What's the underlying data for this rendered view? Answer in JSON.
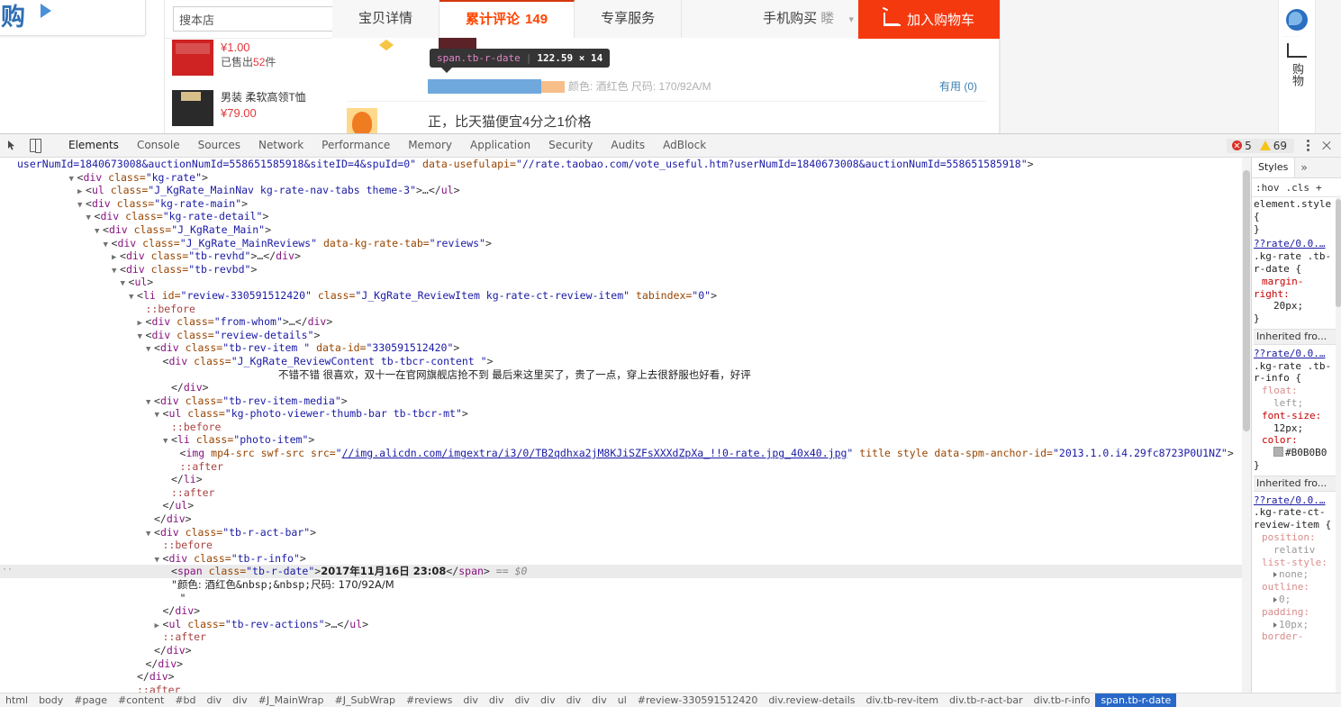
{
  "webpage": {
    "brand": {
      "logo_text": "购",
      "play_icon": "play-triangle-icon"
    },
    "search": {
      "value": "搜本店",
      "placeholder": "搜本店",
      "button_icon": "search-icon"
    },
    "products": [
      {
        "price": "¥1.00",
        "sold_prefix": "已售出",
        "sold_count": "52",
        "sold_suffix": "件",
        "title": ""
      },
      {
        "title": "男装 柔软高领T恤",
        "price": "¥79.00"
      }
    ],
    "tabs": [
      {
        "label": "宝贝详情",
        "active": false
      },
      {
        "label": "累计评论",
        "count": "149",
        "active": true
      },
      {
        "label": "专享服务",
        "active": false
      },
      {
        "label": "手机购买 ",
        "badge": "䁖",
        "caret": "chevron-down-icon",
        "active": false
      }
    ],
    "cart_button": {
      "label": "加入购物车",
      "icon": "cart-icon",
      "color": "#f5390f"
    },
    "review": {
      "date_highlight": "2017年11月16日 23:08",
      "attrs": "颜色: 酒红色  尺码: 170/92A/M",
      "useful": "有用 (0)",
      "second_review": "正，比天猫便宜4分之1价格"
    },
    "inspector_tooltip": {
      "selector": "span.tb-r-date",
      "dimensions": "122.59 × 14"
    },
    "rightrail": {
      "label": "购物"
    }
  },
  "devtools": {
    "toolbar": {
      "inspect_icon": "inspect-cursor-icon",
      "device_icon": "device-toolbar-icon",
      "tabs": [
        "Elements",
        "Console",
        "Sources",
        "Network",
        "Performance",
        "Memory",
        "Application",
        "Security",
        "Audits",
        "AdBlock"
      ],
      "active_tab": "Elements",
      "error_count": "5",
      "warning_count": "69",
      "menu_icon": "kebab-menu-icon",
      "close_icon": "close-icon"
    },
    "dom_lines": [
      {
        "indent": 0,
        "arrow": "none",
        "html": "<span class='tk-val'>userNumId=1840673008&amp;auctionNumId=558651585918&amp;siteID=4&amp;spuId=0\"</span> <span class='tk-attr'>data-usefulapi=</span><span class='tk-val'>\"//rate.taobao.com/vote_useful.htm?userNumId=1840673008&amp;auctionNumId=558651585918\"</span><span class='tk-punc'>&gt;</span>"
      },
      {
        "indent": 7,
        "arrow": "open",
        "html": "<span class='tk-punc'>&lt;</span><span class='tk-tag'>div</span> <span class='tk-attr'>class=</span><span class='tk-val'>\"kg-rate\"</span><span class='tk-punc'>&gt;</span>"
      },
      {
        "indent": 8,
        "arrow": "closed",
        "html": "<span class='tk-punc'>&lt;</span><span class='tk-tag'>ul</span> <span class='tk-attr'>class=</span><span class='tk-val'>\"J_KgRate_MainNav kg-rate-nav-tabs theme-3\"</span><span class='tk-punc'>&gt;…&lt;/</span><span class='tk-tag'>ul</span><span class='tk-punc'>&gt;</span>"
      },
      {
        "indent": 8,
        "arrow": "open",
        "html": "<span class='tk-punc'>&lt;</span><span class='tk-tag'>div</span> <span class='tk-attr'>class=</span><span class='tk-val'>\"kg-rate-main\"</span><span class='tk-punc'>&gt;</span>"
      },
      {
        "indent": 9,
        "arrow": "open",
        "html": "<span class='tk-punc'>&lt;</span><span class='tk-tag'>div</span> <span class='tk-attr'>class=</span><span class='tk-val'>\"kg-rate-detail\"</span><span class='tk-punc'>&gt;</span>"
      },
      {
        "indent": 10,
        "arrow": "open",
        "html": "<span class='tk-punc'>&lt;</span><span class='tk-tag'>div</span> <span class='tk-attr'>class=</span><span class='tk-val'>\"J_KgRate_Main\"</span><span class='tk-punc'>&gt;</span>"
      },
      {
        "indent": 11,
        "arrow": "open",
        "html": "<span class='tk-punc'>&lt;</span><span class='tk-tag'>div</span> <span class='tk-attr'>class=</span><span class='tk-val'>\"J_KgRate_MainReviews\"</span> <span class='tk-attr'>data-kg-rate-tab=</span><span class='tk-val'>\"reviews\"</span><span class='tk-punc'>&gt;</span>"
      },
      {
        "indent": 12,
        "arrow": "closed",
        "html": "<span class='tk-punc'>&lt;</span><span class='tk-tag'>div</span> <span class='tk-attr'>class=</span><span class='tk-val'>\"tb-revhd\"</span><span class='tk-punc'>&gt;…&lt;/</span><span class='tk-tag'>div</span><span class='tk-punc'>&gt;</span>"
      },
      {
        "indent": 12,
        "arrow": "open",
        "html": "<span class='tk-punc'>&lt;</span><span class='tk-tag'>div</span> <span class='tk-attr'>class=</span><span class='tk-val'>\"tb-revbd\"</span><span class='tk-punc'>&gt;</span>"
      },
      {
        "indent": 13,
        "arrow": "open",
        "html": "<span class='tk-punc'>&lt;</span><span class='tk-tag'>ul</span><span class='tk-punc'>&gt;</span>"
      },
      {
        "indent": 14,
        "arrow": "open",
        "html": "<span class='tk-punc'>&lt;</span><span class='tk-tag'>li</span> <span class='tk-attr'>id=</span><span class='tk-val'>\"review-330591512420\"</span> <span class='tk-attr'>class=</span><span class='tk-val'>\"J_KgRate_ReviewItem kg-rate-ct-review-item\"</span> <span class='tk-attr'>tabindex=</span><span class='tk-val'>\"0\"</span><span class='tk-punc'>&gt;</span>"
      },
      {
        "indent": 15,
        "arrow": "none",
        "html": "<span class='tk-pseudo'>::before</span>"
      },
      {
        "indent": 15,
        "arrow": "closed",
        "html": "<span class='tk-punc'>&lt;</span><span class='tk-tag'>div</span> <span class='tk-attr'>class=</span><span class='tk-val'>\"from-whom\"</span><span class='tk-punc'>&gt;…&lt;/</span><span class='tk-tag'>div</span><span class='tk-punc'>&gt;</span>"
      },
      {
        "indent": 15,
        "arrow": "open",
        "html": "<span class='tk-punc'>&lt;</span><span class='tk-tag'>div</span> <span class='tk-attr'>class=</span><span class='tk-val'>\"review-details\"</span><span class='tk-punc'>&gt;</span>"
      },
      {
        "indent": 16,
        "arrow": "open",
        "html": "<span class='tk-punc'>&lt;</span><span class='tk-tag'>div</span> <span class='tk-attr'>class=</span><span class='tk-val'>\"tb-rev-item \"</span> <span class='tk-attr'>data-id=</span><span class='tk-val'>\"330591512420\"</span><span class='tk-punc'>&gt;</span>"
      },
      {
        "indent": 17,
        "arrow": "none",
        "html": "<span class='tk-punc'>&lt;</span><span class='tk-tag'>div</span> <span class='tk-attr'>class=</span><span class='tk-val'>\"J_KgRate_ReviewContent tb-tbcr-content \"</span><span class='tk-punc'>&gt;</span>"
      },
      {
        "indent": 0,
        "arrow": "none",
        "center": true,
        "html": "<span class='tk-cjk'>不错不错 很喜欢，双十一在官网旗舰店抢不到 最后来这里买了，贵了一点，穿上去很舒服也好看，好评</span>"
      },
      {
        "indent": 18,
        "arrow": "none",
        "html": "<span class='tk-punc'>&lt;/</span><span class='tk-tag'>div</span><span class='tk-punc'>&gt;</span>"
      },
      {
        "indent": 16,
        "arrow": "open",
        "html": "<span class='tk-punc'>&lt;</span><span class='tk-tag'>div</span> <span class='tk-attr'>class=</span><span class='tk-val'>\"tb-rev-item-media\"</span><span class='tk-punc'>&gt;</span>"
      },
      {
        "indent": 17,
        "arrow": "open",
        "html": "<span class='tk-punc'>&lt;</span><span class='tk-tag'>ul</span> <span class='tk-attr'>class=</span><span class='tk-val'>\"kg-photo-viewer-thumb-bar tb-tbcr-mt\"</span><span class='tk-punc'>&gt;</span>"
      },
      {
        "indent": 18,
        "arrow": "none",
        "html": "<span class='tk-pseudo'>::before</span>"
      },
      {
        "indent": 18,
        "arrow": "open",
        "html": "<span class='tk-punc'>&lt;</span><span class='tk-tag'>li</span> <span class='tk-attr'>class=</span><span class='tk-val'>\"photo-item\"</span><span class='tk-punc'>&gt;</span>"
      },
      {
        "indent": 19,
        "arrow": "none",
        "html": "<span class='tk-punc'>&lt;</span><span class='tk-tag'>img</span> <span class='tk-attr'>mp4-src</span> <span class='tk-attr'>swf-src</span> <span class='tk-attr'>src=</span><span class='tk-val'>\"</span><span class='tk-link'>//img.alicdn.com/imgextra/i3/0/TB2qdhxa2jM8KJiSZFsXXXdZpXa_!!0-rate.jpg_40x40.jpg</span><span class='tk-val'>\"</span> <span class='tk-attr'>title</span> <span class='tk-attr'>style</span> <span class='tk-attr'>data-spm-anchor-id=</span><span class='tk-val'>\"2013.1.0.i4.29fc8723P0U1NZ\"</span><span class='tk-punc'>&gt;</span>"
      },
      {
        "indent": 19,
        "arrow": "none",
        "html": "<span class='tk-pseudo'>::after</span>"
      },
      {
        "indent": 18,
        "arrow": "none",
        "html": "<span class='tk-punc'>&lt;/</span><span class='tk-tag'>li</span><span class='tk-punc'>&gt;</span>"
      },
      {
        "indent": 18,
        "arrow": "none",
        "html": "<span class='tk-pseudo'>::after</span>"
      },
      {
        "indent": 17,
        "arrow": "none",
        "html": "<span class='tk-punc'>&lt;/</span><span class='tk-tag'>ul</span><span class='tk-punc'>&gt;</span>"
      },
      {
        "indent": 16,
        "arrow": "none",
        "html": "<span class='tk-punc'>&lt;/</span><span class='tk-tag'>div</span><span class='tk-punc'>&gt;</span>"
      },
      {
        "indent": 16,
        "arrow": "open",
        "html": "<span class='tk-punc'>&lt;</span><span class='tk-tag'>div</span> <span class='tk-attr'>class=</span><span class='tk-val'>\"tb-r-act-bar\"</span><span class='tk-punc'>&gt;</span>"
      },
      {
        "indent": 17,
        "arrow": "none",
        "html": "<span class='tk-pseudo'>::before</span>"
      },
      {
        "indent": 17,
        "arrow": "open",
        "html": "<span class='tk-punc'>&lt;</span><span class='tk-tag'>div</span> <span class='tk-attr'>class=</span><span class='tk-val'>\"tb-r-info\"</span><span class='tk-punc'>&gt;</span>"
      },
      {
        "indent": 18,
        "arrow": "none",
        "selected": true,
        "html": "<span class='tk-punc'>&lt;</span><span class='tk-tag'>span</span> <span class='tk-attr'>class=</span><span class='tk-val'>\"tb-r-date\"</span><span class='tk-punc'>&gt;</span><b class='tk-cjk'>2017年11月16日  23:08</b><span class='tk-punc'>&lt;/</span><span class='tk-tag'>span</span><span class='tk-punc'>&gt;</span> <span class='tk-eq'>== $0</span>"
      },
      {
        "indent": 18,
        "arrow": "none",
        "html": "<span class='tk-txt'>\"</span><span class='tk-cjk'>颜色: 酒红色</span><span class='tk-txt'>&amp;nbsp;&amp;nbsp;</span><span class='tk-cjk'>尺码: 170/92A/M</span>"
      },
      {
        "indent": 19,
        "arrow": "none",
        "html": "<span class='tk-txt'>\"</span>"
      },
      {
        "indent": 17,
        "arrow": "none",
        "html": "<span class='tk-punc'>&lt;/</span><span class='tk-tag'>div</span><span class='tk-punc'>&gt;</span>"
      },
      {
        "indent": 17,
        "arrow": "closed",
        "html": "<span class='tk-punc'>&lt;</span><span class='tk-tag'>ul</span> <span class='tk-attr'>class=</span><span class='tk-val'>\"tb-rev-actions\"</span><span class='tk-punc'>&gt;…&lt;/</span><span class='tk-tag'>ul</span><span class='tk-punc'>&gt;</span>"
      },
      {
        "indent": 17,
        "arrow": "none",
        "html": "<span class='tk-pseudo'>::after</span>"
      },
      {
        "indent": 16,
        "arrow": "none",
        "html": "<span class='tk-punc'>&lt;/</span><span class='tk-tag'>div</span><span class='tk-punc'>&gt;</span>"
      },
      {
        "indent": 15,
        "arrow": "none",
        "html": "<span class='tk-punc'>&lt;/</span><span class='tk-tag'>div</span><span class='tk-punc'>&gt;</span>"
      },
      {
        "indent": 14,
        "arrow": "none",
        "html": "<span class='tk-punc'>&lt;/</span><span class='tk-tag'>div</span><span class='tk-punc'>&gt;</span>"
      },
      {
        "indent": 14,
        "arrow": "none",
        "html": "<span class='tk-pseudo'>::after</span>"
      }
    ],
    "styles": {
      "tab_label": "Styles",
      "more_icon": "chevron-right-icon",
      "filters": [
        ":hov",
        ".cls",
        "+"
      ],
      "rules": [
        {
          "source": "",
          "selector": "element.style {",
          "declarations": [],
          "close": "}"
        },
        {
          "source": "??rate/0.0.…",
          "selector": ".kg-rate .tb-r-date {",
          "declarations": [
            {
              "prop": "margin-right:",
              "value": "20px;",
              "dim": false
            }
          ],
          "close": "}"
        },
        {
          "inherit_label": "Inherited fro...",
          "source": "??rate/0.0.…",
          "selector": ".kg-rate .tb-r-info {",
          "declarations": [
            {
              "prop": "float:",
              "value": "left;",
              "dim": true
            },
            {
              "prop": "font-size:",
              "value": "12px;",
              "dim": false
            },
            {
              "prop": "color:",
              "value": "#B0B0B0",
              "swatch": "#B0B0B0",
              "dim": false
            }
          ],
          "close": "}"
        },
        {
          "inherit_label": "Inherited fro...",
          "source": "??rate/0.0.…",
          "selector": ".kg-rate-ct-review-item {",
          "declarations": [
            {
              "prop": "position:",
              "value": "relativ",
              "dim": true
            },
            {
              "prop": "list-style:",
              "value": "none;",
              "tri": true,
              "dim": true
            },
            {
              "prop": "outline:",
              "value": "0;",
              "tri": true,
              "dim": true
            },
            {
              "prop": "padding:",
              "value": "10px;",
              "tri": true,
              "dim": true
            },
            {
              "prop": "border-",
              "value": "",
              "dim": true
            }
          ],
          "close": ""
        }
      ]
    },
    "breadcrumbs": [
      "html",
      "body",
      "#page",
      "#content",
      "#bd",
      "div",
      "div",
      "#J_MainWrap",
      "#J_SubWrap",
      "#reviews",
      "div",
      "div",
      "div",
      "div",
      "div",
      "div",
      "ul",
      "#review-330591512420",
      "div.review-details",
      "div.tb-rev-item",
      "div.tb-r-act-bar",
      "div.tb-r-info",
      "span.tb-r-date"
    ],
    "breadcrumb_active": "span.tb-r-date"
  }
}
